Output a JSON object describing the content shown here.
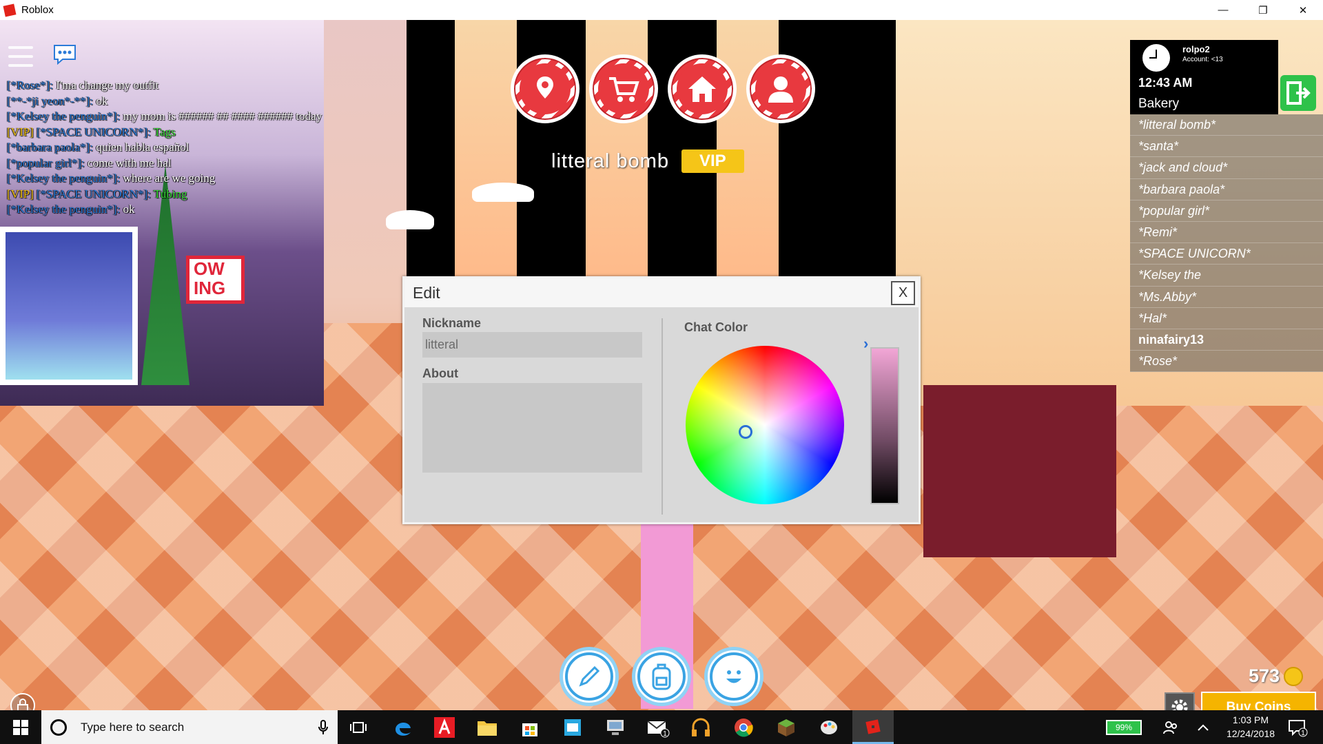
{
  "window": {
    "title": "Roblox",
    "minimize": "—",
    "restore": "❐",
    "close": "✕"
  },
  "chat": {
    "lines": [
      {
        "tag": "",
        "name": "[*Rose*]:",
        "message": " I'ma change my outfit",
        "green": false
      },
      {
        "tag": "",
        "name": "[**-*ji yeon*-**]:",
        "message": " ok",
        "green": false
      },
      {
        "tag": "",
        "name": "[*Kelsey the penguin*]:",
        "message": " my mom is ###### ## #### ###### today",
        "green": false
      },
      {
        "tag": "[VIP] ",
        "name": "[*SPACE UNICORN*]:",
        "message": " Tags",
        "green": true
      },
      {
        "tag": "",
        "name": "[*barbara paola*]:",
        "message": " quien habla español",
        "green": false
      },
      {
        "tag": "",
        "name": "[*popular girl*]:",
        "message": " come with me hal",
        "green": false
      },
      {
        "tag": "",
        "name": "[*Kelsey the penguin*]:",
        "message": " where are we going",
        "green": false
      },
      {
        "tag": "[VIP] ",
        "name": "[*SPACE UNICORN*]:",
        "message": " Tubing",
        "green": true
      },
      {
        "tag": "",
        "name": "[*Kelsey the penguin*]:",
        "message": " ok",
        "green": false
      }
    ]
  },
  "overhead": {
    "nickname": "litteral bomb",
    "badge": "VIP"
  },
  "scene": {
    "sign_text": "OW\nING"
  },
  "player": {
    "username": "rolpo2",
    "account": "Account: <13",
    "time": "12:43 AM",
    "place": "Bakery"
  },
  "players": [
    {
      "name": "*litteral bomb*",
      "italic": true
    },
    {
      "name": "*santa*",
      "italic": true
    },
    {
      "name": "*jack and cloud*",
      "italic": true
    },
    {
      "name": "*barbara paola*",
      "italic": true
    },
    {
      "name": "*popular girl*",
      "italic": true
    },
    {
      "name": "*Remi*",
      "italic": true
    },
    {
      "name": "*SPACE UNICORN*",
      "italic": true
    },
    {
      "name": "*Kelsey the",
      "italic": true
    },
    {
      "name": "*Ms.Abby*",
      "italic": true
    },
    {
      "name": "*Hal*",
      "italic": true
    },
    {
      "name": "ninafairy13",
      "italic": false
    },
    {
      "name": "*Rose*",
      "italic": true
    }
  ],
  "modal": {
    "title": "Edit",
    "close_label": "X",
    "nickname_label": "Nickname",
    "nickname_value": "litteral",
    "about_label": "About",
    "chat_color_label": "Chat Color",
    "slider_arrow": "›"
  },
  "currency": {
    "amount": "573",
    "buy_label": "Buy Coins"
  },
  "taskbar": {
    "search_placeholder": "Type here to search",
    "battery": "99%",
    "time": "1:03 PM",
    "date": "12/24/2018",
    "mail_badge": "1",
    "notif_badge": "1"
  },
  "colors": {
    "nav_red": "#e8393f",
    "vip_gold": "#f5c518",
    "chat_name_blue": "#2b7bd8",
    "chat_green": "#3bdf3b",
    "leave_green": "#2ec24a",
    "bottom_blue": "#3aa3e3",
    "buy_gold": "#f5b400"
  }
}
